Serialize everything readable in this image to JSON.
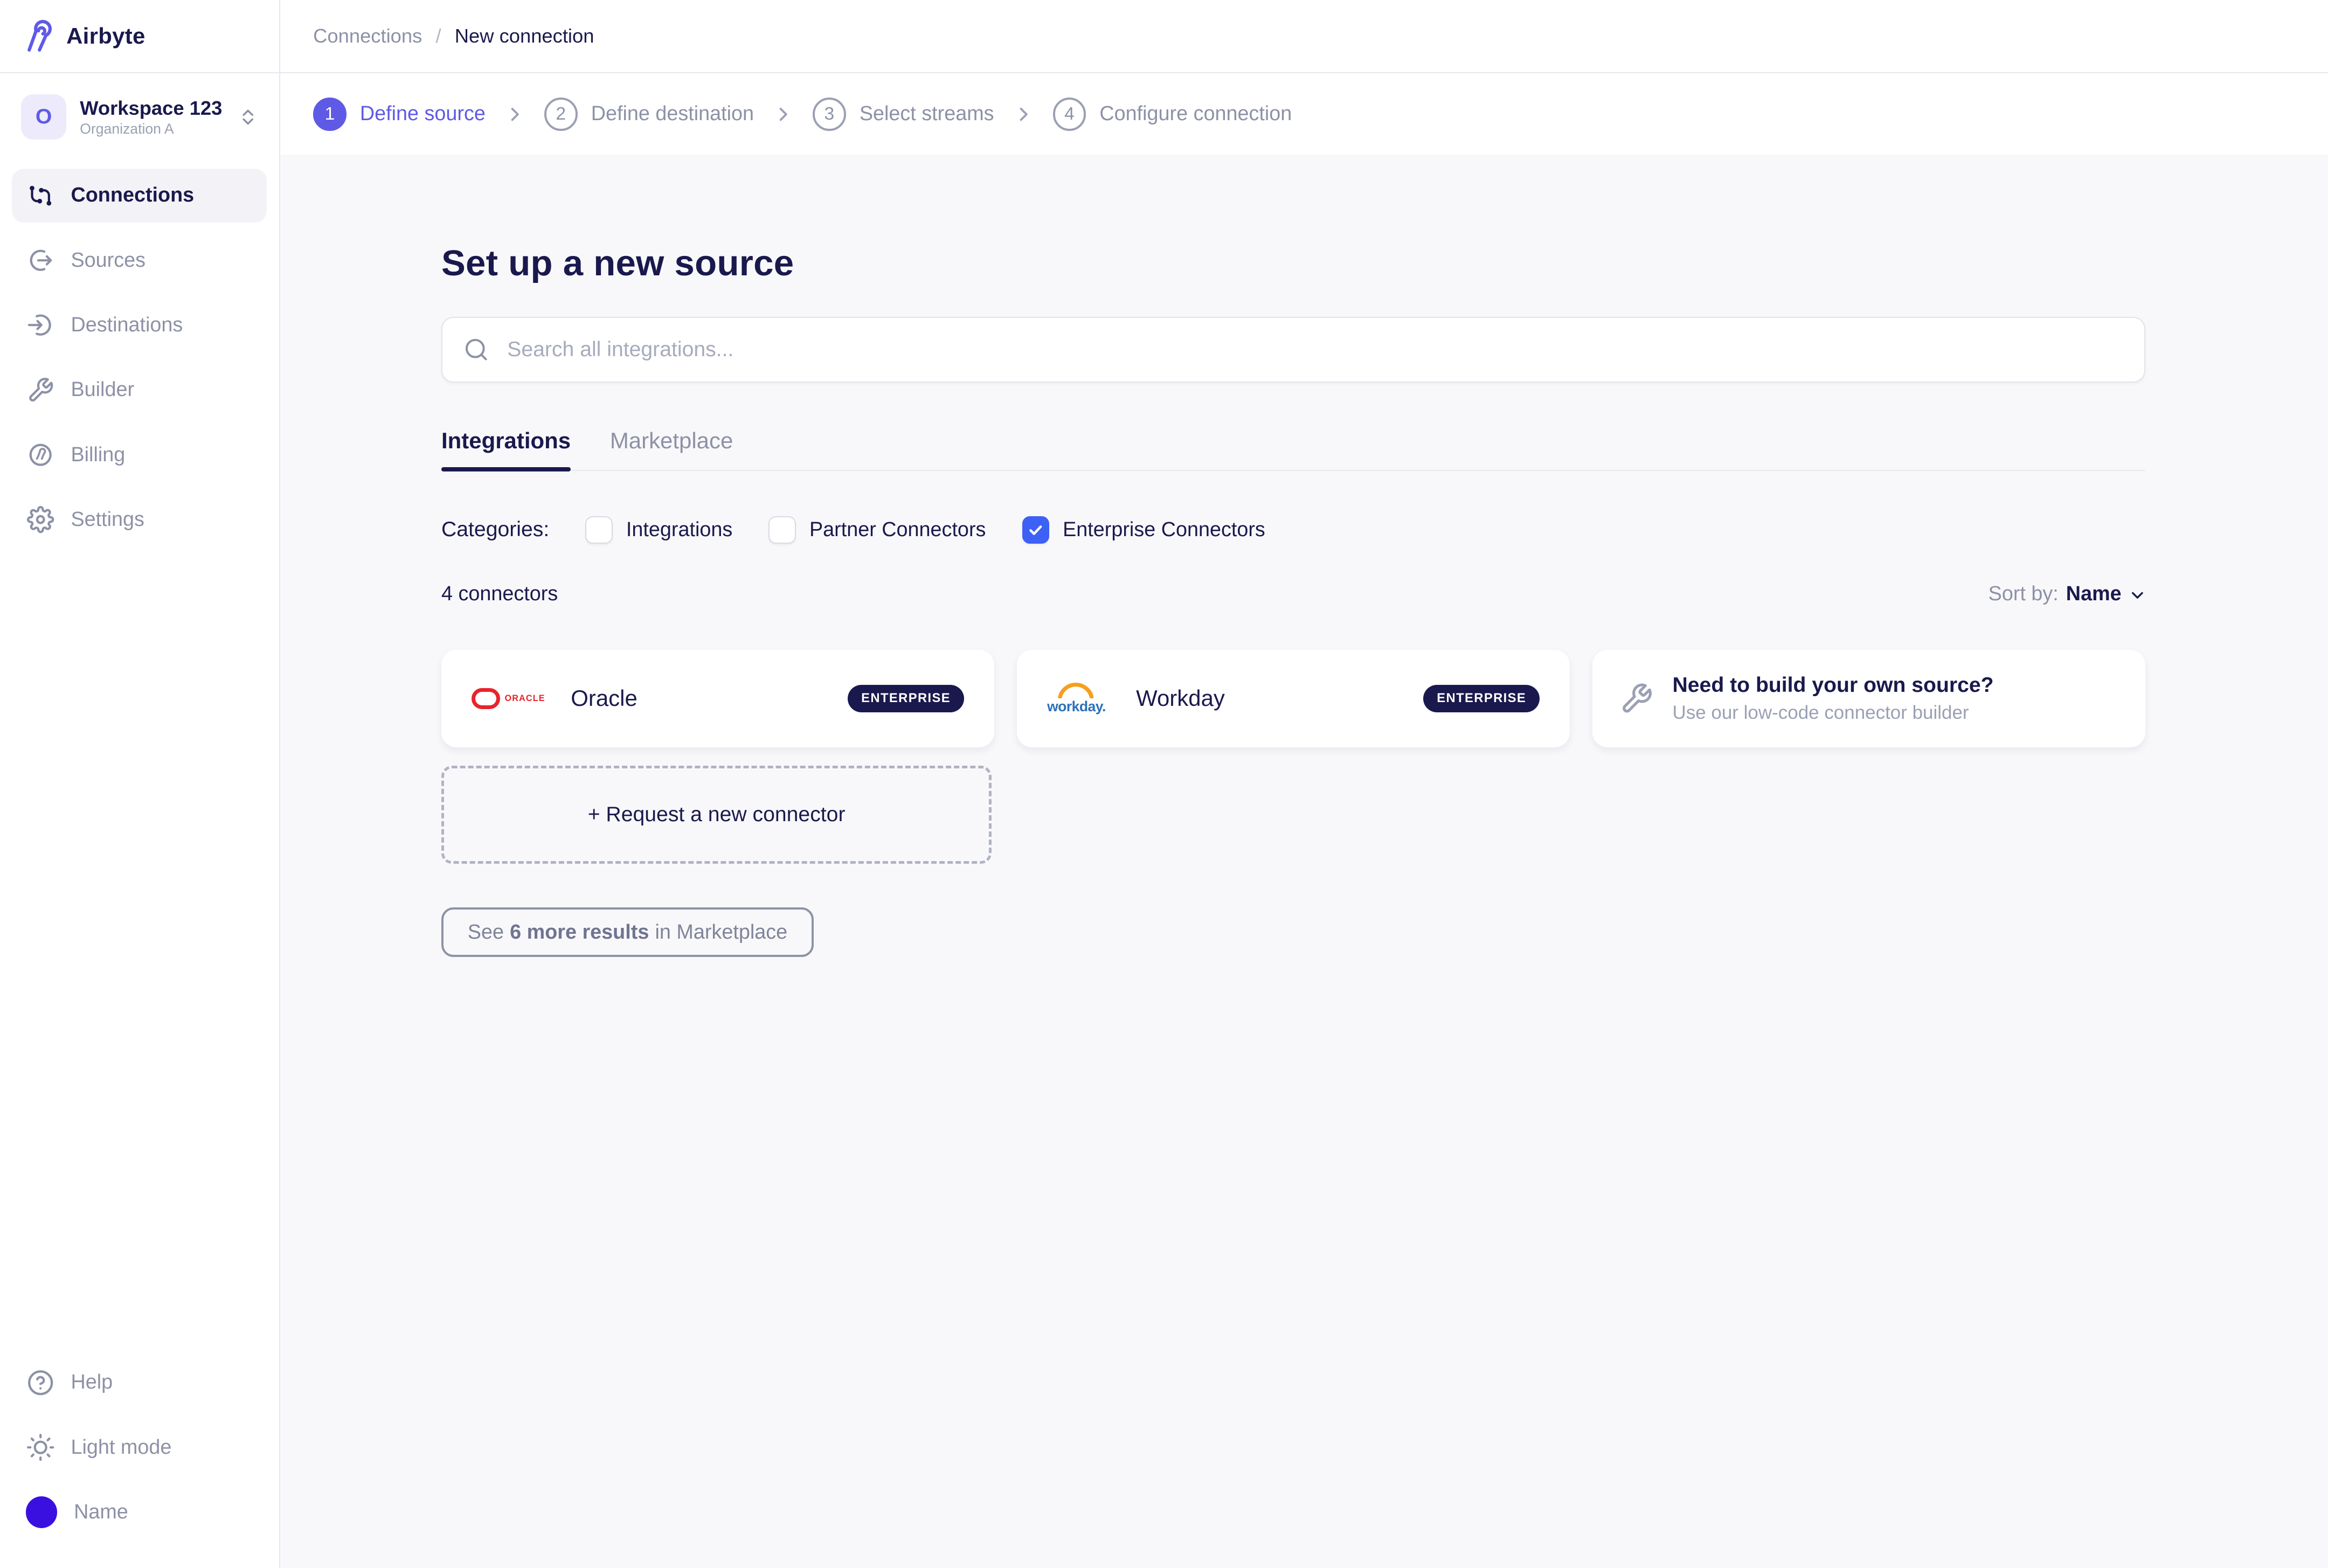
{
  "brand": {
    "name": "Airbyte",
    "accent_color": "#5f5ae6",
    "navy_color": "#1a194d"
  },
  "workspace": {
    "initial": "O",
    "name": "Workspace 123",
    "org": "Organization A"
  },
  "sidebar": {
    "items": [
      {
        "label": "Connections",
        "icon": "connections-icon",
        "active": true
      },
      {
        "label": "Sources",
        "icon": "source-out-icon",
        "active": false
      },
      {
        "label": "Destinations",
        "icon": "destination-in-icon",
        "active": false
      },
      {
        "label": "Builder",
        "icon": "wrench-icon",
        "active": false
      },
      {
        "label": "Billing",
        "icon": "billing-icon",
        "active": false
      },
      {
        "label": "Settings",
        "icon": "gear-icon",
        "active": false
      }
    ],
    "footer": {
      "help": "Help",
      "theme": "Light mode",
      "user": "Name"
    }
  },
  "breadcrumb": {
    "parent": "Connections",
    "separator": "/",
    "current": "New connection"
  },
  "stepper": {
    "steps": [
      {
        "num": "1",
        "label": "Define source",
        "active": true
      },
      {
        "num": "2",
        "label": "Define destination",
        "active": false
      },
      {
        "num": "3",
        "label": "Select streams",
        "active": false
      },
      {
        "num": "4",
        "label": "Configure connection",
        "active": false
      }
    ]
  },
  "main": {
    "title": "Set up a new source",
    "search_placeholder": "Search all integrations...",
    "tabs": [
      {
        "label": "Integrations",
        "active": true
      },
      {
        "label": "Marketplace",
        "active": false
      }
    ],
    "categories_label": "Categories:",
    "categories": [
      {
        "label": "Integrations",
        "checked": false
      },
      {
        "label": "Partner Connectors",
        "checked": false
      },
      {
        "label": "Enterprise Connectors",
        "checked": true
      }
    ],
    "checkbox_checked_color": "#3d60f5",
    "count_text": "4 connectors",
    "sort_label": "Sort by:",
    "sort_value": "Name",
    "connectors": [
      {
        "name": "Oracle",
        "badge": "ENTERPRISE",
        "logo": "oracle-logo",
        "logo_colors": {
          "red": "#e9232b"
        }
      },
      {
        "name": "Workday",
        "badge": "ENTERPRISE",
        "logo": "workday-logo",
        "logo_colors": {
          "blue": "#2d72b9",
          "orange": "#f69f1d"
        }
      }
    ],
    "builder_card": {
      "title": "Need to build your own source?",
      "subtitle": "Use our low-code connector builder",
      "icon": "wrench-icon"
    },
    "request_button": "+ Request a new connector",
    "see_more": {
      "prefix": "See",
      "bold": "6 more results",
      "suffix": "in Marketplace"
    }
  }
}
